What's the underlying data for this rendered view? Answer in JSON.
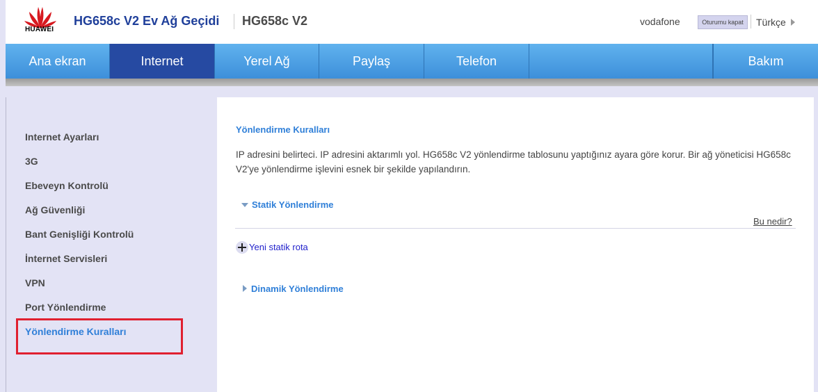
{
  "header": {
    "brand": "HUAWEI",
    "title": "HG658c V2 Ev Ağ Geçidi",
    "model": "HG658c V2",
    "user": "vodafone",
    "logout_label": "Oturumu kapat",
    "language": "Türkçe"
  },
  "nav": {
    "items": [
      {
        "label": "Ana ekran"
      },
      {
        "label": "Internet"
      },
      {
        "label": "Yerel Ağ"
      },
      {
        "label": "Paylaş"
      },
      {
        "label": "Telefon"
      },
      {
        "label": "Bakım"
      }
    ],
    "active": "Internet"
  },
  "sidebar": {
    "items": [
      {
        "label": "Internet Ayarları"
      },
      {
        "label": "3G"
      },
      {
        "label": "Ebeveyn Kontrolü"
      },
      {
        "label": "Ağ Güvenliği"
      },
      {
        "label": "Bant Genişliği Kontrolü"
      },
      {
        "label": "İnternet Servisleri"
      },
      {
        "label": "VPN"
      },
      {
        "label": "Port Yönlendirme"
      },
      {
        "label": "Yönlendirme Kuralları"
      }
    ],
    "active": "Yönlendirme Kuralları"
  },
  "main": {
    "title": "Yönlendirme Kuralları",
    "description": "IP adresini belirteci. IP adresini aktarımlı yol. HG658c V2 yönlendirme tablosunu yaptığınız ayara göre korur. Bir ağ yöneticisi HG658c V2'ye yönlendirme işlevini esnek bir şekilde yapılandırın.",
    "static_section": "Statik Yönlendirme",
    "help_link": "Bu nedir?",
    "add_route": "Yeni statik rota",
    "dynamic_section": "Dinamik Yönlendirme"
  },
  "colors": {
    "accent": "#2f7fd8",
    "nav_active": "#264aa2",
    "highlight": "#e02030"
  }
}
